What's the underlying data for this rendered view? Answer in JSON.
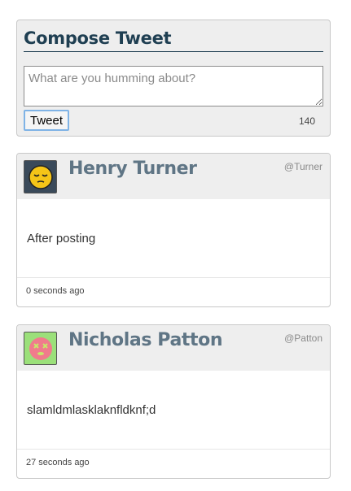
{
  "compose": {
    "title": "Compose Tweet",
    "placeholder": "What are you humming about?",
    "button_label": "Tweet",
    "char_count": "140"
  },
  "tweets": [
    {
      "name": "Henry Turner",
      "handle": "@Turner",
      "text": "After posting",
      "time": "0 seconds ago",
      "avatar_icon": "sleepy-face-icon",
      "avatar_bg": "#3a4a5a"
    },
    {
      "name": "Nicholas Patton",
      "handle": "@Patton",
      "text": "slamldmlasklaknfldknf;d",
      "time": "27 seconds ago",
      "avatar_icon": "dizzy-face-icon",
      "avatar_bg": "#9be07a"
    }
  ]
}
